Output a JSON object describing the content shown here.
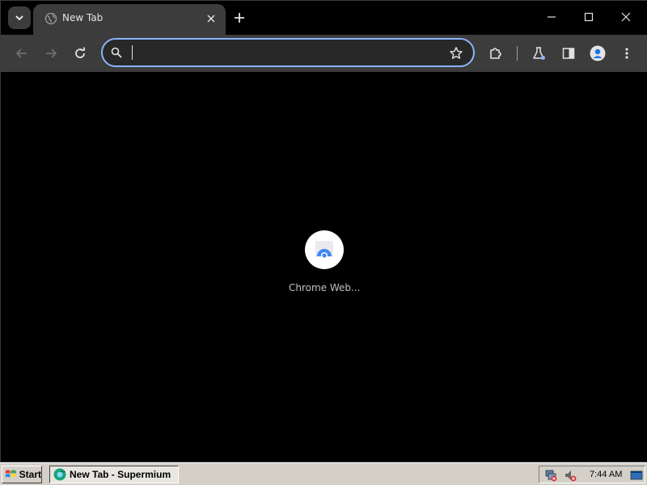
{
  "browser": {
    "tab": {
      "title": "New Tab"
    },
    "omnibox": {
      "value": "",
      "placeholder": ""
    },
    "accent": "#8ab4f8"
  },
  "content": {
    "shortcut": {
      "title": "Chrome Web..."
    }
  },
  "taskbar": {
    "start_label": "Start",
    "task_label": "New Tab - Supermium",
    "clock": "7:44 AM"
  }
}
